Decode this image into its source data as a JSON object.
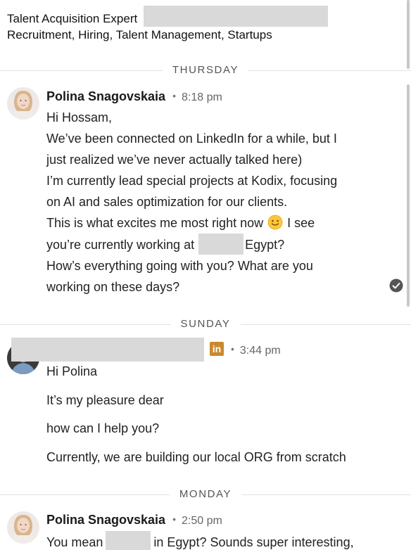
{
  "header": {
    "title_line": "Talent Acquisition Expert",
    "subtitle_line": "Recruitment, Hiring, Talent Management, Startups"
  },
  "days": {
    "thursday": "THURSDAY",
    "sunday": "SUNDAY",
    "monday": "MONDAY"
  },
  "messages": [
    {
      "sender": "Polina Snagovskaia",
      "time": "8:18 pm",
      "lines": [
        "Hi Hossam,",
        "We’ve been connected on LinkedIn for a while, but I",
        "just realized we’ve never actually talked here)",
        "I’m currently lead special projects at Kodix, focusing",
        "on AI and sales optimization for our clients.",
        "This is what excites me most right now",
        "I see",
        "you’re currently working at",
        "Egypt?",
        "How’s everything going with you? What are you",
        "working on these days?"
      ]
    },
    {
      "sender": "",
      "time": "3:44 pm",
      "badge": "in",
      "lines": [
        "Hi Polina",
        "It’s my pleasure dear",
        "how can I help you?",
        "Currently, we are building our local ORG from scratch"
      ]
    },
    {
      "sender": "Polina Snagovskaia",
      "time": "2:50 pm",
      "lines": [
        "You mean",
        "in Egypt? Sounds super interesting,"
      ]
    }
  ],
  "icons": {
    "emoji": "slightly-smiling-face",
    "read_receipt": "check-circle-icon",
    "linkedin_badge": "linkedin-icon"
  },
  "colors": {
    "separator": "#e2e2e2",
    "redaction": "#d9d9d9",
    "linkedin_badge": "#c98a2e"
  }
}
